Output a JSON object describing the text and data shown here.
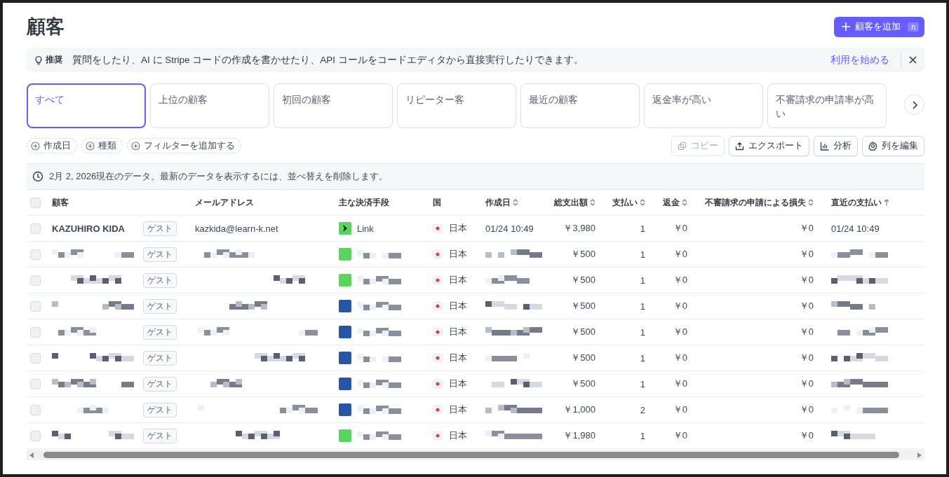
{
  "page": {
    "title": "顧客"
  },
  "add_button": {
    "label": "顧客を追加",
    "shortcut": "n"
  },
  "banner": {
    "tag": "推奨",
    "message": "質問をしたり、AI に Stripe コードの作成を書かせたり、API コールをコードエディタから直接実行したりできます。",
    "link": "利用を始める"
  },
  "tabs": [
    {
      "label": "すべて",
      "selected": true,
      "faded": false
    },
    {
      "label": "上位の顧客",
      "selected": false,
      "faded": false
    },
    {
      "label": "初回の顧客",
      "selected": false,
      "faded": false
    },
    {
      "label": "リピーター客",
      "selected": false,
      "faded": false
    },
    {
      "label": "最近の顧客",
      "selected": false,
      "faded": false
    },
    {
      "label": "返金率が高い",
      "selected": false,
      "faded": false
    },
    {
      "label": "不審請求の申請率が高い",
      "selected": false,
      "faded": false
    }
  ],
  "filters": [
    "作成日",
    "種類",
    "フィルターを追加する"
  ],
  "actions": [
    {
      "kind": "copy",
      "label": "コピー",
      "disabled": true
    },
    {
      "kind": "export",
      "label": "エクスポート",
      "disabled": false
    },
    {
      "kind": "chart",
      "label": "分析",
      "disabled": false
    },
    {
      "kind": "gear",
      "label": "列を編集",
      "disabled": false
    }
  ],
  "notice": "2月 2, 2026現在のデータ。最新のデータを表示するには、並べ替えを削除します。",
  "table": {
    "select_all": {
      "checked": false
    },
    "columns": [
      {
        "label": "顧客",
        "kind": "plain"
      },
      {
        "label": "メールアドレス",
        "kind": "plain"
      },
      {
        "label": "主な決済手段",
        "kind": "plain"
      },
      {
        "label": "国",
        "kind": "plain"
      },
      {
        "label": "作成日",
        "kind": "sortable"
      },
      {
        "label": "総支出額",
        "kind": "sortable"
      },
      {
        "label": "支払い",
        "kind": "sortable"
      },
      {
        "label": "返金",
        "kind": "sortable"
      },
      {
        "label": "不審請求の申請による損失",
        "kind": "sortable"
      },
      {
        "label": "直近の支払い",
        "kind": "ascending"
      }
    ],
    "rows": [
      {
        "checked": false,
        "redacted": false,
        "name": "KAZUHIRO KIDA",
        "type": "ゲスト",
        "email": "kazkida@learn-k.net",
        "method": "Link",
        "color": "#5bd45e",
        "country": "日本",
        "created": "01/24 10:49",
        "total": "￥3,980",
        "payments": "1",
        "refunds": "￥0",
        "dispute_loss": "￥0",
        "last_payment": "01/24 10:49"
      },
      {
        "checked": false,
        "redacted": true,
        "type": "ゲスト",
        "color": "#5bd45e",
        "country": "日本",
        "total": "￥500",
        "payments": "1",
        "refunds": "￥0",
        "dispute_loss": "￥0"
      },
      {
        "checked": false,
        "redacted": true,
        "type": "ゲスト",
        "color": "#5bd45e",
        "country": "日本",
        "total": "￥500",
        "payments": "1",
        "refunds": "￥0",
        "dispute_loss": "￥0"
      },
      {
        "checked": false,
        "redacted": true,
        "type": "ゲスト",
        "color": "#2757a4",
        "country": "日本",
        "total": "￥500",
        "payments": "1",
        "refunds": "￥0",
        "dispute_loss": "￥0"
      },
      {
        "checked": false,
        "redacted": true,
        "type": "ゲスト",
        "color": "#2757a4",
        "country": "日本",
        "total": "￥500",
        "payments": "1",
        "refunds": "￥0",
        "dispute_loss": "￥0"
      },
      {
        "checked": false,
        "redacted": true,
        "type": "ゲスト",
        "color": "#2757a4",
        "country": "日本",
        "total": "￥500",
        "payments": "1",
        "refunds": "￥0",
        "dispute_loss": "￥0"
      },
      {
        "checked": false,
        "redacted": true,
        "type": "ゲスト",
        "color": "#2757a4",
        "country": "日本",
        "total": "￥500",
        "payments": "1",
        "refunds": "￥0",
        "dispute_loss": "￥0"
      },
      {
        "checked": false,
        "redacted": true,
        "type": "ゲスト",
        "color": "#2757a4",
        "country": "日本",
        "total": "￥1,000",
        "payments": "2",
        "refunds": "￥0",
        "dispute_loss": "￥0"
      },
      {
        "checked": false,
        "redacted": true,
        "type": "ゲスト",
        "color": "#5bd45e",
        "country": "日本",
        "total": "￥1,980",
        "payments": "1",
        "refunds": "￥0",
        "dispute_loss": "￥0"
      }
    ]
  }
}
